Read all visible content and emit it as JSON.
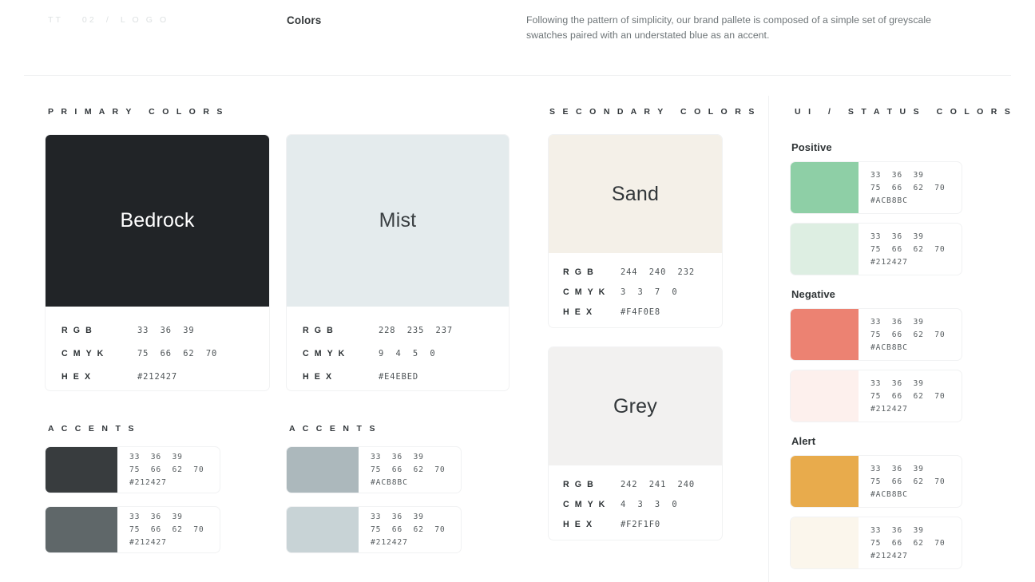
{
  "header": {
    "eyebrow": "TT    02  /  L O G O",
    "title": "Colors",
    "description": "Following the pattern of simplicity, our brand pallete is composed of a simple set of greyscale swatches paired with an understated blue as an accent."
  },
  "sections": {
    "primary": "P R I M A R Y   C O L O R S",
    "secondary": "S E C O N D A R Y   C O L O R S",
    "status": "U I   /   S T A T U S   C O L O R S",
    "accents_left": "A C C E N T S",
    "accents_right": "A C C E N T S"
  },
  "meta_keys": {
    "rgb": "R G B",
    "cmyk": "C M Y K",
    "hex": "H E X"
  },
  "primary": [
    {
      "name": "Bedrock",
      "swatch_color": "#212427",
      "label_color": "#ffffff",
      "rgb": "33  36  39",
      "cmyk": "75  66  62  70",
      "hex": "#212427"
    },
    {
      "name": "Mist",
      "swatch_color": "#e4ebed",
      "label_color": "#3a3f42",
      "rgb": "228  235  237",
      "cmyk": "9  4  5  0",
      "hex": "#E4EBED"
    }
  ],
  "secondary": [
    {
      "name": "Sand",
      "swatch_color": "#f4f0e8",
      "label_color": "#32373a",
      "rgb": "244  240  232",
      "cmyk": "3  3  7  0",
      "hex": "#F4F0E8"
    },
    {
      "name": "Grey",
      "swatch_color": "#f2f1f0",
      "label_color": "#32373a",
      "rgb": "242  241  240",
      "cmyk": "4  3  3  0",
      "hex": "#F2F1F0"
    }
  ],
  "accents_left": [
    {
      "swatch_color": "#383c3e",
      "rgb": "33  36  39",
      "cmyk": "75  66  62  70",
      "hex": "#212427"
    },
    {
      "swatch_color": "#5f6769",
      "rgb": "33  36  39",
      "cmyk": "75  66  62  70",
      "hex": "#212427"
    }
  ],
  "accents_right": [
    {
      "swatch_color": "#acb8bc",
      "rgb": "33  36  39",
      "cmyk": "75  66  62  70",
      "hex": "#ACB8BC"
    },
    {
      "swatch_color": "#c8d3d6",
      "rgb": "33  36  39",
      "cmyk": "75  66  62  70",
      "hex": "#212427"
    }
  ],
  "status_groups": [
    {
      "label": "Positive",
      "swatches": [
        {
          "swatch_color": "#8ecfa6",
          "rgb": "33  36  39",
          "cmyk": "75  66  62  70",
          "hex": "#ACB8BC"
        },
        {
          "swatch_color": "#ddeee2",
          "rgb": "33  36  39",
          "cmyk": "75  66  62  70",
          "hex": "#212427"
        }
      ]
    },
    {
      "label": "Negative",
      "swatches": [
        {
          "swatch_color": "#ec8272",
          "rgb": "33  36  39",
          "cmyk": "75  66  62  70",
          "hex": "#ACB8BC"
        },
        {
          "swatch_color": "#fdf0ed",
          "rgb": "33  36  39",
          "cmyk": "75  66  62  70",
          "hex": "#212427"
        }
      ]
    },
    {
      "label": "Alert",
      "swatches": [
        {
          "swatch_color": "#e8ab4c",
          "rgb": "33  36  39",
          "cmyk": "75  66  62  70",
          "hex": "#ACB8BC"
        },
        {
          "swatch_color": "#fbf6ec",
          "rgb": "33  36  39",
          "cmyk": "75  66  62  70",
          "hex": "#212427"
        }
      ]
    }
  ]
}
